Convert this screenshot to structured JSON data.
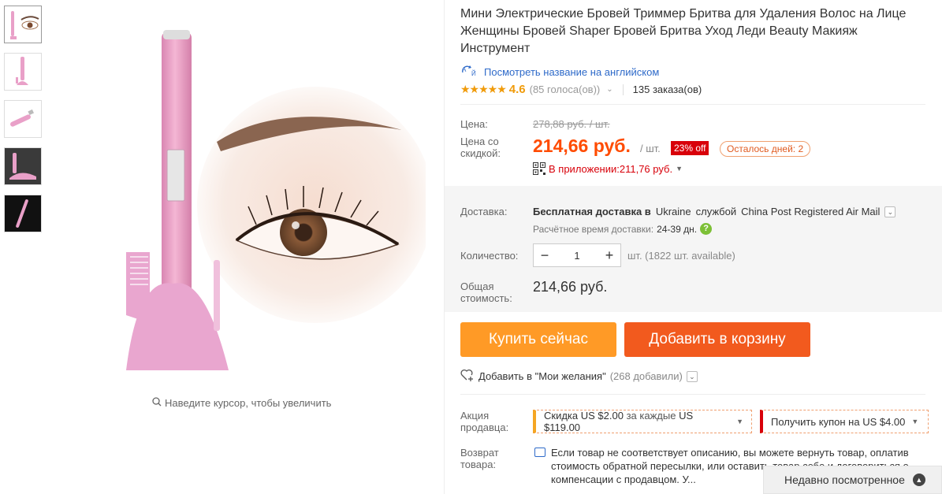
{
  "gallery": {
    "thumbnails": [
      "thumb-eye",
      "thumb-trimmer",
      "thumb-trimmer-side",
      "thumb-trimmer-dark",
      "thumb-trimmer-black"
    ],
    "zoom_hint": "Наведите курсор, чтобы увеличить"
  },
  "product": {
    "title": "Мини Электрические Бровей Триммер Бритва для Удаления Волос на Лице Женщины Бровей Shaper Бровей Бритва Уход Леди Beauty Макияж Инструмент",
    "translate_link": "Посмотреть название на английском",
    "rating": "4.6",
    "votes": "(85 голоса(ов))",
    "orders": "135 заказа(ов)"
  },
  "price": {
    "label_price": "Цена:",
    "old_price": "278,88 руб. / шт.",
    "label_discount_price": "Цена со скидкой:",
    "price": "214,66 руб.",
    "per_unit": "/ шт.",
    "discount_badge": "23% off",
    "days_left": "Осталось дней: 2",
    "app_price": "В приложении:211,76 руб."
  },
  "shipping": {
    "label": "Доставка:",
    "text_prefix": "Бесплатная доставка в",
    "country": "Ukraine",
    "text_mid": "службой",
    "carrier": "China Post Registered Air Mail",
    "eta_label": "Расчётное время доставки:",
    "eta_value": "24-39 дн."
  },
  "quantity": {
    "label": "Количество:",
    "value": "1",
    "available": "шт. (1822 шт. available)"
  },
  "total": {
    "label": "Общая стоимость:",
    "value": "214,66 руб."
  },
  "actions": {
    "buy_now": "Купить сейчас",
    "add_to_cart": "Добавить в корзину",
    "wishlist": "Добавить в \"Мои желания\"",
    "wishlist_count": "(268 добавили)"
  },
  "promo": {
    "label": "Акция продавца:",
    "discount_prefix": "Скидка",
    "discount_amount": "US $2.00",
    "discount_mid": "за каждые",
    "discount_threshold": "US $119.00",
    "coupon_prefix": "Получить купон на",
    "coupon_amount": "US $4.00"
  },
  "returns": {
    "label": "Возврат товара:",
    "text": "Если товар не соответствует описанию, вы можете вернуть товар, оплатив стоимость обратной пересылки, или оставить товар себе и договориться о компенсации с продавцом. У..."
  },
  "recently_viewed": {
    "label": "Недавно посмотренное"
  },
  "colors": {
    "accent_orange": "#ff4b00",
    "buy_button": "#ff9a26",
    "cart_button": "#f25a1e",
    "star": "#f09b0a",
    "link": "#2e6ac9",
    "discount_red": "#d8000a"
  }
}
